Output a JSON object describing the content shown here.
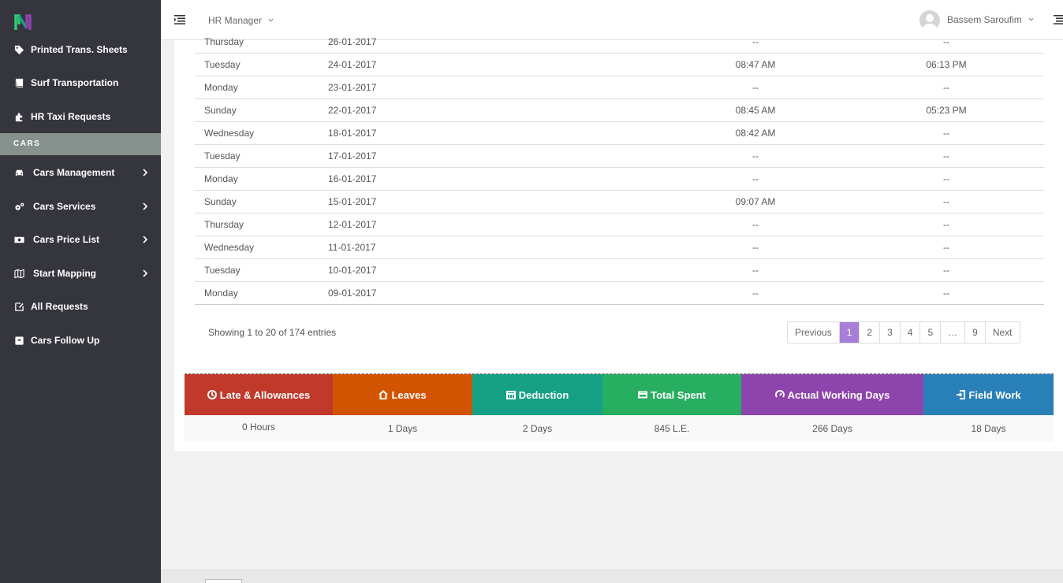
{
  "sidebar": {
    "items_top": [
      {
        "label": "Printed Trans. Sheets",
        "icon": "tag-icon"
      },
      {
        "label": "Surf Transportation",
        "icon": "book-icon"
      },
      {
        "label": "HR Taxi Requests",
        "icon": "puzzle-icon"
      }
    ],
    "section": "CARS",
    "items_cars": [
      {
        "label": "Cars Management",
        "icon": "car-icon"
      },
      {
        "label": "Cars Services",
        "icon": "gears-icon"
      },
      {
        "label": "Cars Price List",
        "icon": "money-icon"
      },
      {
        "label": "Start Mapping",
        "icon": "map-icon"
      },
      {
        "label": "All Requests",
        "icon": "edit-icon"
      },
      {
        "label": "Cars Follow Up",
        "icon": "archive-icon"
      }
    ]
  },
  "header": {
    "role": "HR Manager",
    "user": "Bassem Saroufim"
  },
  "table": {
    "rows": [
      {
        "day": "Thursday",
        "date": "26-01-2017",
        "in": "--",
        "out": "--"
      },
      {
        "day": "Tuesday",
        "date": "24-01-2017",
        "in": "08:47 AM",
        "out": "06:13 PM"
      },
      {
        "day": "Monday",
        "date": "23-01-2017",
        "in": "--",
        "out": "--"
      },
      {
        "day": "Sunday",
        "date": "22-01-2017",
        "in": "08:45 AM",
        "out": "05:23 PM"
      },
      {
        "day": "Wednesday",
        "date": "18-01-2017",
        "in": "08:42 AM",
        "out": "--"
      },
      {
        "day": "Tuesday",
        "date": "17-01-2017",
        "in": "--",
        "out": "--"
      },
      {
        "day": "Monday",
        "date": "16-01-2017",
        "in": "--",
        "out": "--"
      },
      {
        "day": "Sunday",
        "date": "15-01-2017",
        "in": "09:07 AM",
        "out": "--"
      },
      {
        "day": "Thursday",
        "date": "12-01-2017",
        "in": "--",
        "out": "--"
      },
      {
        "day": "Wednesday",
        "date": "11-01-2017",
        "in": "--",
        "out": "--"
      },
      {
        "day": "Tuesday",
        "date": "10-01-2017",
        "in": "--",
        "out": "--"
      },
      {
        "day": "Monday",
        "date": "09-01-2017",
        "in": "--",
        "out": "--"
      }
    ]
  },
  "pagination": {
    "showing": "Showing 1 to 20 of 174 entries",
    "previous": "Previous",
    "pages": [
      "1",
      "2",
      "3",
      "4",
      "5",
      "…",
      "9"
    ],
    "active": "1",
    "next": "Next"
  },
  "stats": [
    {
      "label": "Late & Allowances",
      "value": "0 Hours",
      "color": "#c0392b",
      "icon": "clock-icon"
    },
    {
      "label": "Leaves",
      "value": "1 Days",
      "color": "#d35400",
      "icon": "home-icon"
    },
    {
      "label": "Deduction",
      "value": "2 Days",
      "color": "#16a085",
      "icon": "calendar-icon"
    },
    {
      "label": "Total Spent",
      "value": "845 L.E.",
      "color": "#27ae60",
      "icon": "credit-card-icon"
    },
    {
      "label": "Actual Working Days",
      "value": "266 Days",
      "color": "#8e44ad",
      "icon": "dashboard-icon"
    },
    {
      "label": "Field Work",
      "value": "18 Days",
      "color": "#2980b9",
      "icon": "sign-in-icon"
    }
  ]
}
